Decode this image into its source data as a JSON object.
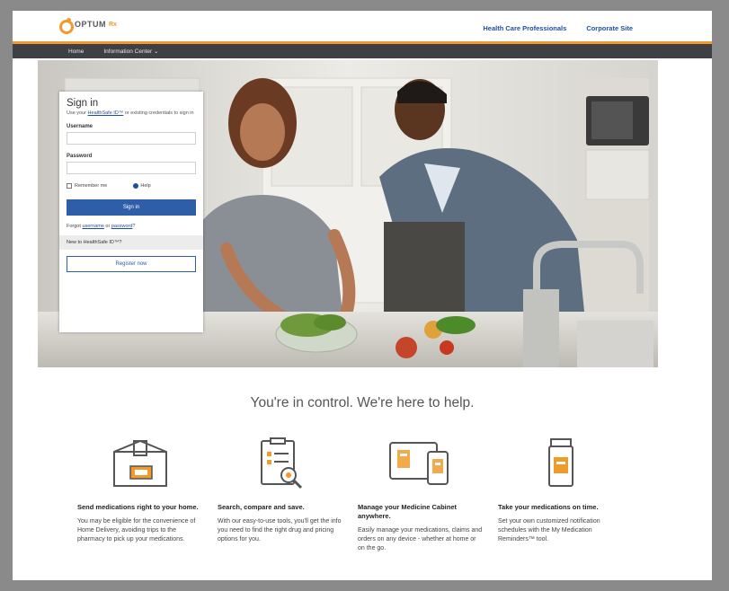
{
  "header": {
    "logo_text": "OPTUM",
    "logo_rx": "Rx",
    "links": [
      "Health Care Professionals",
      "Corporate Site"
    ]
  },
  "nav": {
    "items": [
      "Home",
      "Information Center ⌄"
    ]
  },
  "signin": {
    "title": "Sign in",
    "subtitle_pre": "Use your ",
    "subtitle_link": "HealthSafe ID™",
    "subtitle_post": " or existing credentials to sign in",
    "username_label": "Username",
    "password_label": "Password",
    "remember_label": "Remember me",
    "help_label": "Help",
    "signin_button": "Sign in",
    "forgot_pre": "Forgot ",
    "forgot_username": "username",
    "forgot_or": " or ",
    "forgot_password": "password",
    "forgot_post": "?",
    "new_to": "New to HealthSafe ID™?",
    "register_button": "Register now"
  },
  "tagline": "You're in control. We're here to help.",
  "features": [
    {
      "icon": "box-icon",
      "title": "Send medications right to your home.",
      "body": "You may be eligible for the convenience of Home Delivery, avoiding trips to the pharmacy to pick up your medications."
    },
    {
      "icon": "clipboard-search-icon",
      "title": "Search, compare and save.",
      "body": "With our easy-to-use tools, you'll get the info you need to find the right drug and pricing options for you."
    },
    {
      "icon": "devices-icon",
      "title": "Manage your Medicine Cabinet anywhere.",
      "body": "Easily manage your medications, claims and orders on any device - whether at home or on the go."
    },
    {
      "icon": "pill-bottle-icon",
      "title": "Take your medications on time.",
      "body": "Set your own customized notification schedules with the My Medication Reminders™ tool."
    }
  ],
  "colors": {
    "brand_orange": "#f19b2c",
    "brand_blue": "#2e5ea8",
    "nav_bg": "#3f3f46"
  }
}
